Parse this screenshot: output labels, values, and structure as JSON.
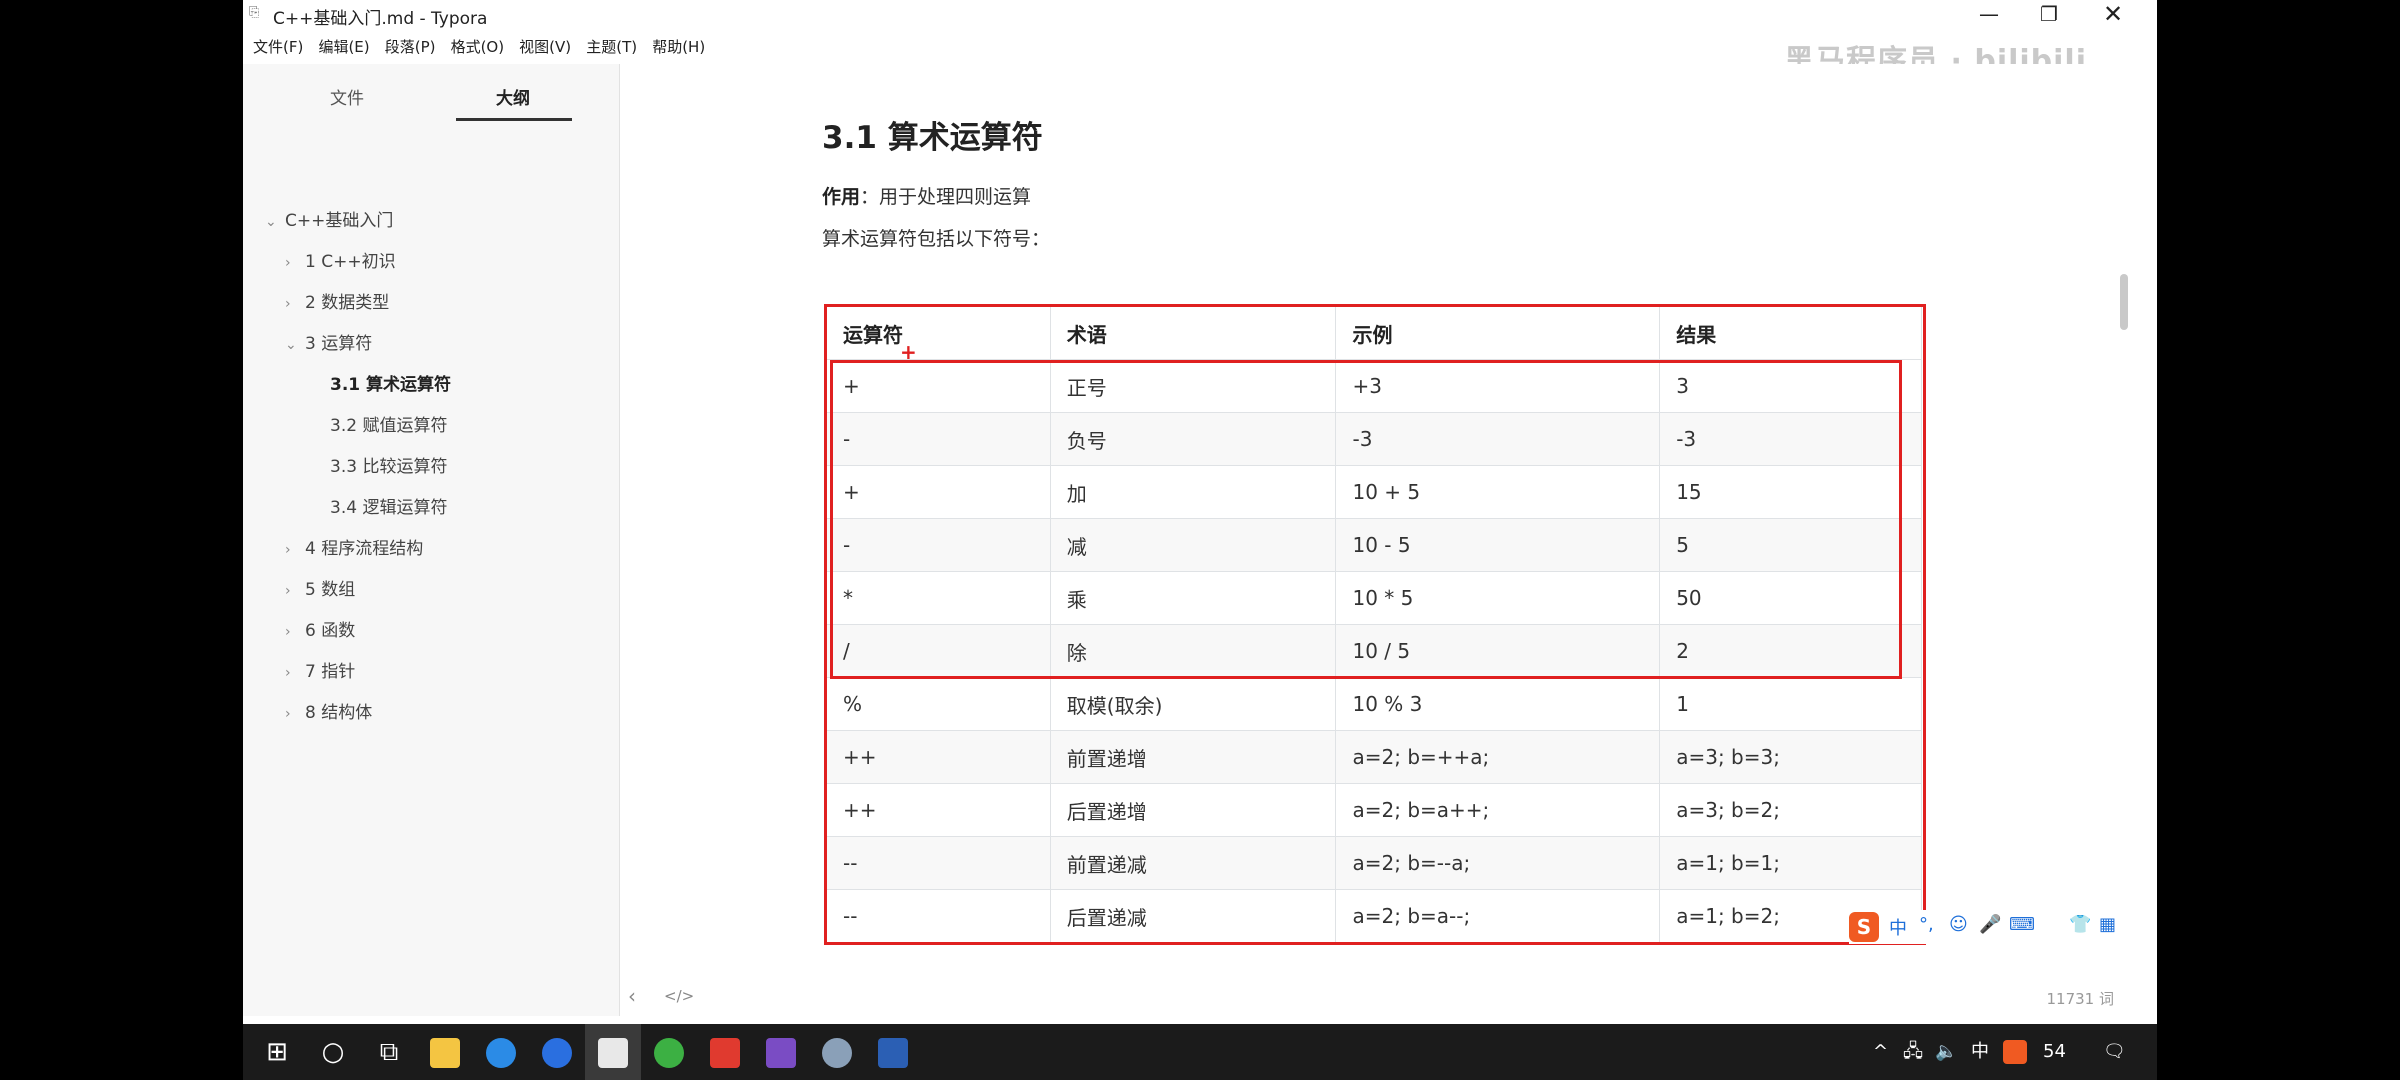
{
  "window": {
    "title": "C++基础入门.md - Typora",
    "minimize_glyph": "—",
    "maximize_glyph": "❐",
    "close_glyph": "✕"
  },
  "menu": [
    "文件(F)",
    "编辑(E)",
    "段落(P)",
    "格式(O)",
    "视图(V)",
    "主题(T)",
    "帮助(H)"
  ],
  "watermark": "黑马程序员 · bilibili",
  "sidebar": {
    "tab_files": "文件",
    "tab_outline": "大纲",
    "items": [
      {
        "label": "C++基础入门",
        "arrow": "⌄",
        "level": 0
      },
      {
        "label": "1 C++初识",
        "arrow": "›",
        "level": 1
      },
      {
        "label": "2 数据类型",
        "arrow": "›",
        "level": 1
      },
      {
        "label": "3 运算符",
        "arrow": "⌄",
        "level": 1
      },
      {
        "label": "3.1 算术运算符",
        "arrow": "",
        "level": 2,
        "active": true
      },
      {
        "label": "3.2 赋值运算符",
        "arrow": "",
        "level": 2
      },
      {
        "label": "3.3 比较运算符",
        "arrow": "",
        "level": 2
      },
      {
        "label": "3.4 逻辑运算符",
        "arrow": "",
        "level": 2
      },
      {
        "label": "4 程序流程结构",
        "arrow": "›",
        "level": 1
      },
      {
        "label": "5 数组",
        "arrow": "›",
        "level": 1
      },
      {
        "label": "6 函数",
        "arrow": "›",
        "level": 1
      },
      {
        "label": "7 指针",
        "arrow": "›",
        "level": 1
      },
      {
        "label": "8 结构体",
        "arrow": "›",
        "level": 1
      }
    ]
  },
  "doc": {
    "heading": "3.1 算术运算符",
    "purpose_label": "作用",
    "purpose_text": "：用于处理四则运算",
    "intro": "算术运算符包括以下符号：",
    "table": {
      "headers": [
        "运算符",
        "术语",
        "示例",
        "结果"
      ],
      "rows": [
        [
          "+",
          "正号",
          "+3",
          "3"
        ],
        [
          "-",
          "负号",
          "-3",
          "-3"
        ],
        [
          "+",
          "加",
          "10 + 5",
          "15"
        ],
        [
          "-",
          "减",
          "10 - 5",
          "5"
        ],
        [
          "*",
          "乘",
          "10 * 5",
          "50"
        ],
        [
          "/",
          "除",
          "10 / 5",
          "2"
        ],
        [
          "%",
          "取模(取余)",
          "10 % 3",
          "1"
        ],
        [
          "++",
          "前置递增",
          "a=2; b=++a;",
          "a=3; b=3;"
        ],
        [
          "++",
          "后置递增",
          "a=2; b=a++;",
          "a=3; b=2;"
        ],
        [
          "--",
          "前置递减",
          "a=2; b=--a;",
          "a=1; b=1;"
        ],
        [
          "--",
          "后置递减",
          "a=2; b=a--;",
          "a=1; b=2;"
        ]
      ]
    }
  },
  "annotation_color": "#e02020",
  "ime": {
    "logo": "S",
    "items": [
      "中",
      "°,",
      "☺",
      "🎤",
      "⌨",
      "👕",
      "▦"
    ]
  },
  "status": {
    "prev": "‹",
    "source_toggle": "</>",
    "word_count": "11731 词"
  },
  "taskbar": {
    "tray_chevron": "^",
    "tray_lang": "中",
    "tray_badge": "54",
    "tray_notifications": "🗨"
  }
}
